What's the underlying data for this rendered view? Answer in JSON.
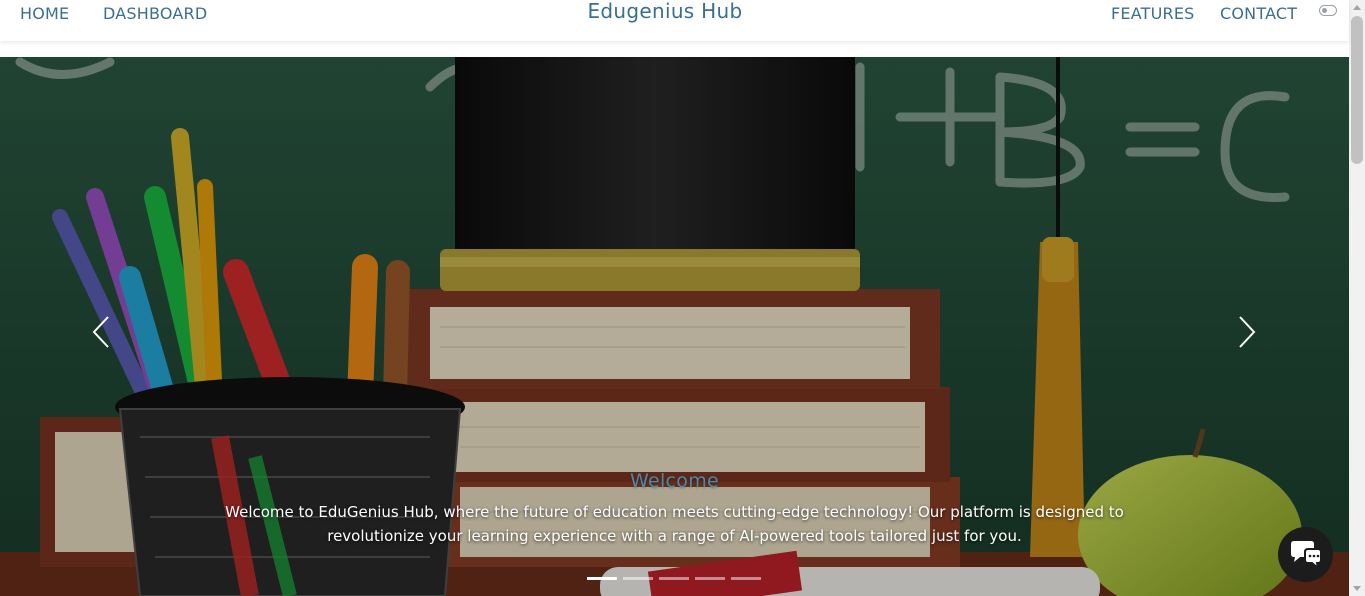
{
  "navbar": {
    "brand": "Edugenius Hub",
    "left_links": [
      "HOME",
      "DASHBOARD"
    ],
    "right_links": [
      "FEATURES",
      "CONTACT"
    ],
    "theme_toggle_icon": "toggle-switch-icon",
    "link_color": "#3b6f8f"
  },
  "carousel": {
    "caption_title": "Welcome",
    "caption_text": "Welcome to EduGenius Hub, where the future of education meets cutting-edge technology! Our platform is designed to revolutionize your learning experience with a range of AI-powered tools tailored just for you.",
    "prev_icon": "chevron-left-icon",
    "next_icon": "chevron-right-icon",
    "indicator_count": 5,
    "active_indicator": 1,
    "title_color": "#4a8aa8"
  },
  "chat": {
    "icon": "chat-bubbles-icon"
  }
}
